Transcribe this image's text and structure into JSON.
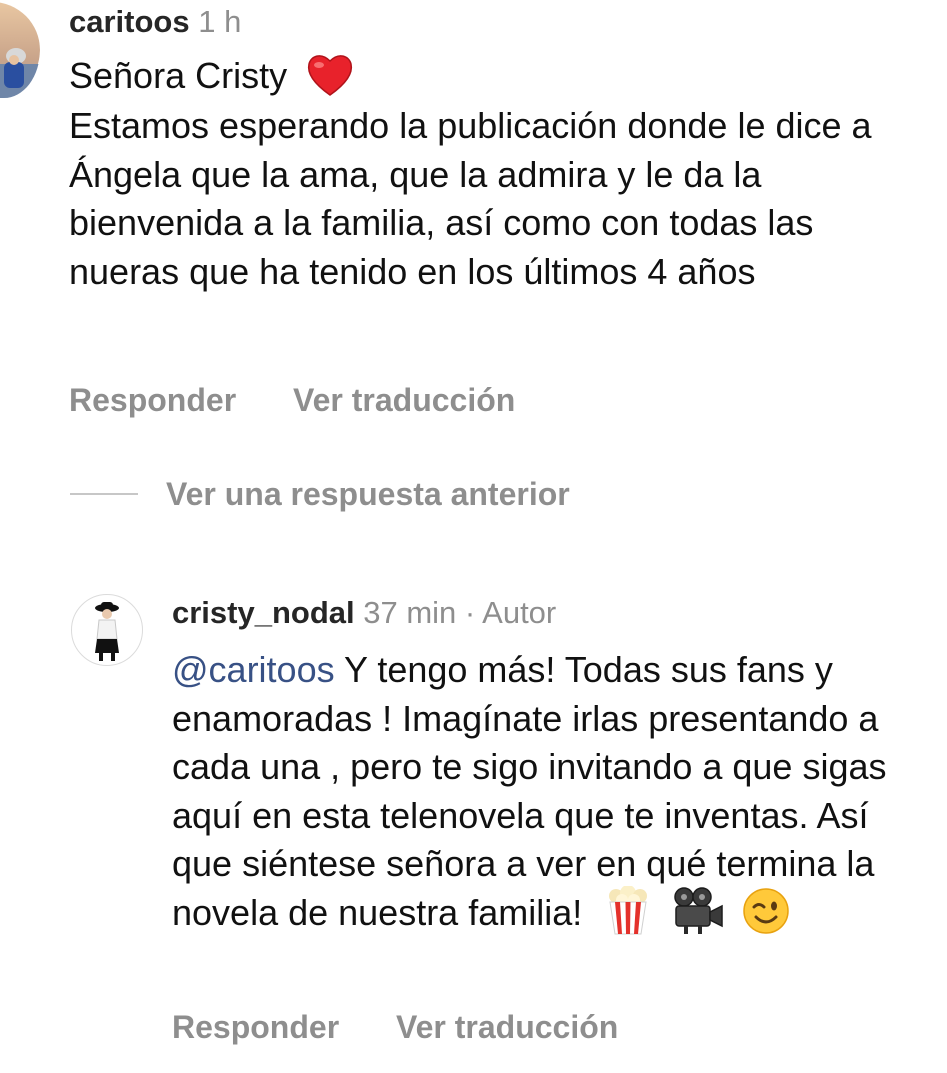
{
  "comment": {
    "username": "caritoos",
    "time": "1 h",
    "body_line1": "Señora Cristy",
    "body_emoji": "heart-emoji",
    "body_paragraph": "Estamos esperando la publicación donde le dice a Ángela que la ama, que la admira y le da la bienvenida a la familia, así como con todas las nueras que ha tenido en los últimos 4 años",
    "reply_label": "Responder",
    "translate_label": "Ver traducción"
  },
  "view_replies": {
    "label": "Ver una respuesta anterior"
  },
  "reply": {
    "username": "cristy_nodal",
    "time": "37 min",
    "separator": "·",
    "author_badge": "Autor",
    "mention": "@caritoos",
    "body": "Y tengo más! Todas sus fans y enamoradas ! Imagínate irlas presentando a cada una , pero te sigo invitando a que sigas aquí en esta telenovela que te inventas. Así que siéntese señora a ver en qué termina la novela de nuestra familia!",
    "emojis": [
      "popcorn-emoji",
      "movie-camera-emoji",
      "winking-face-emoji"
    ],
    "reply_label": "Responder",
    "translate_label": "Ver traducción"
  },
  "colors": {
    "text": "#111111",
    "username": "#262626",
    "muted": "#8e8e8e",
    "mention": "#385185",
    "divider": "#c7c7c7"
  }
}
